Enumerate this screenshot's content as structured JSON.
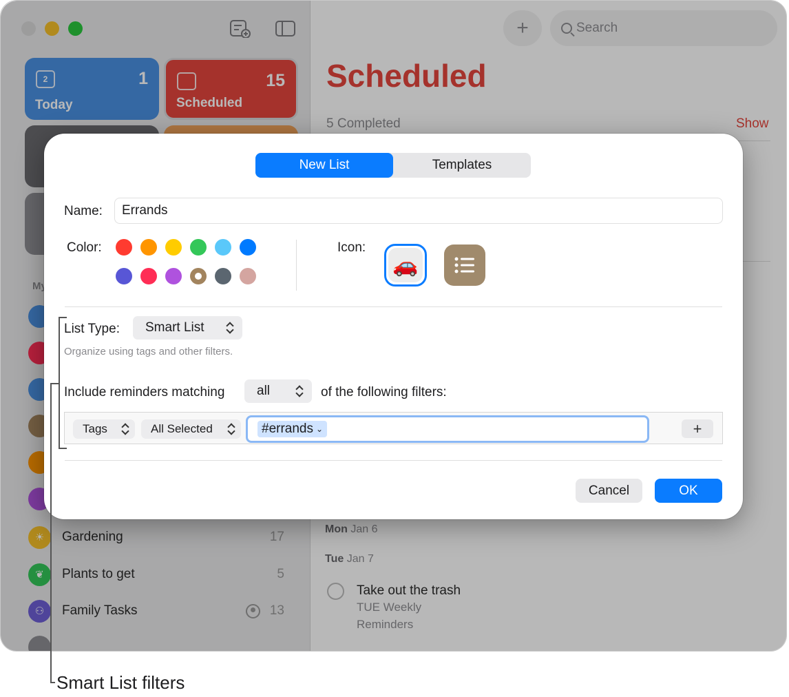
{
  "sidebar": {
    "tiles": [
      {
        "label": "Today",
        "count": "1",
        "color": "#4a90e2",
        "icon_text": "2"
      },
      {
        "label": "Scheduled",
        "count": "15",
        "color": "#e5463e"
      }
    ],
    "section_label": "My",
    "lists": [
      {
        "name": "Gardening",
        "count": "17",
        "color": "#f5c02a"
      },
      {
        "name": "Plants to get",
        "count": "5",
        "color": "#34c759"
      },
      {
        "name": "Family Tasks",
        "count": "13",
        "color": "#6e5fd6",
        "shared": true
      }
    ]
  },
  "toolbar": {
    "search_placeholder": "Search",
    "add_label": "+"
  },
  "main": {
    "title": "Scheduled",
    "completed_text": "5 Completed",
    "show_label": "Show",
    "days": [
      {
        "weekday": "Mon",
        "date": "Jan 6"
      },
      {
        "weekday": "Tue",
        "date": "Jan 7"
      }
    ],
    "reminder": {
      "title": "Take out the trash",
      "sub_line1": "TUE Weekly",
      "sub_line2": "Reminders"
    }
  },
  "dialog": {
    "tabs": [
      "New List",
      "Templates"
    ],
    "active_tab": "New List",
    "name_label": "Name:",
    "name_value": "Errands",
    "color_label": "Color:",
    "colors": [
      "#ff3b30",
      "#ff9500",
      "#ffcc00",
      "#34c759",
      "#5ac8fa",
      "#007aff",
      "#5856d6",
      "#ff2d55",
      "#af52de",
      "#a2845e",
      "#5b6670",
      "#d4a5a0"
    ],
    "selected_color_index": 9,
    "icon_label": "Icon:",
    "icons": [
      "car-emoji-icon",
      "list-icon"
    ],
    "car_glyph": "🚗",
    "list_type_label": "List Type:",
    "list_type_value": "Smart List",
    "list_type_hint": "Organize using tags and other filters.",
    "match_prefix": "Include reminders matching",
    "match_value": "all",
    "match_suffix": "of the following filters:",
    "filter": {
      "field": "Tags",
      "mode": "All Selected",
      "token": "#errands",
      "add_label": "+"
    },
    "cancel_label": "Cancel",
    "ok_label": "OK"
  },
  "callout": {
    "text": "Smart List filters"
  }
}
